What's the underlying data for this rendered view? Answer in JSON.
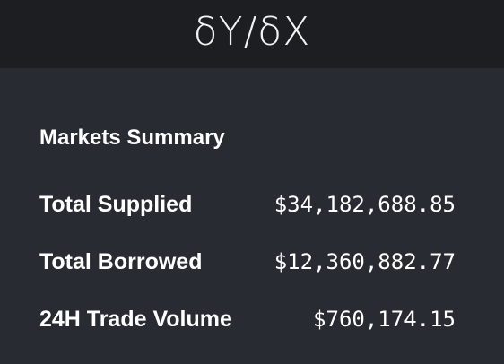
{
  "header": {
    "logo_text": "δY/δX"
  },
  "markets_summary": {
    "title": "Markets Summary",
    "rows": [
      {
        "label": "Total Supplied",
        "value": "$34,182,688.85"
      },
      {
        "label": "Total Borrowed",
        "value": "$12,360,882.77"
      },
      {
        "label": "24H Trade Volume",
        "value": "$760,174.15"
      }
    ]
  }
}
